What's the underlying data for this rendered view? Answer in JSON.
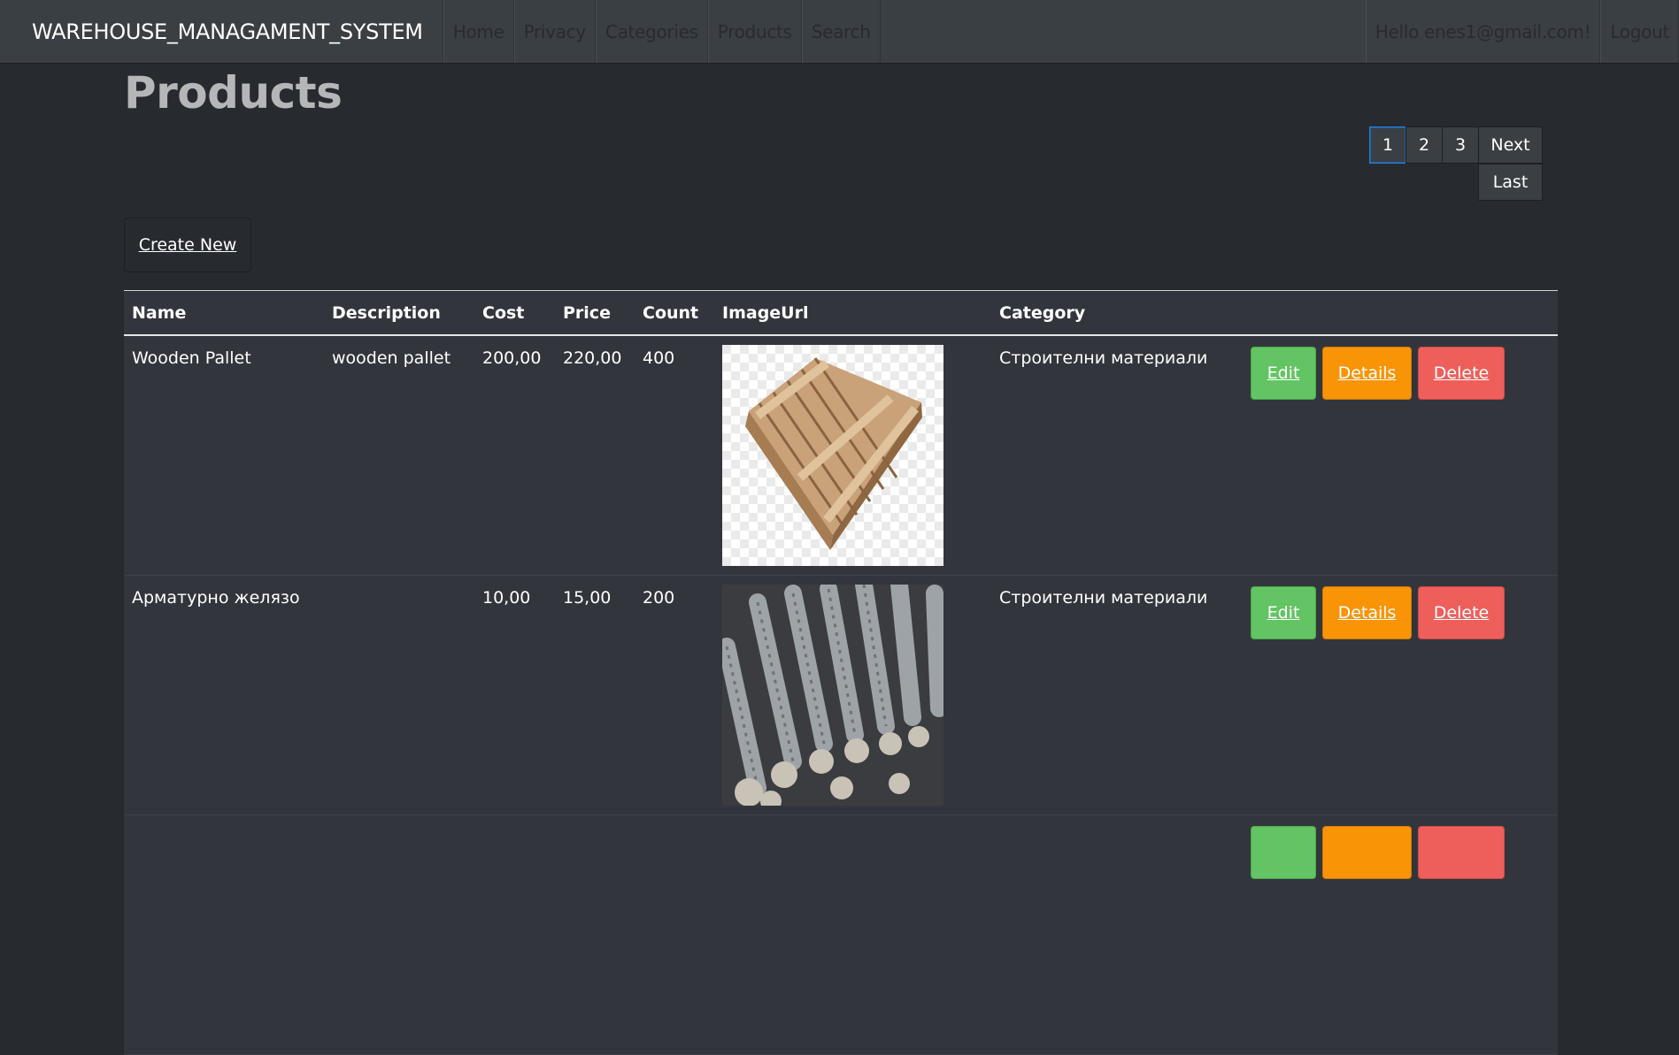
{
  "navbar": {
    "brand": "WAREHOUSE_MANAGAMENT_SYSTEM",
    "items": [
      "Home",
      "Privacy",
      "Categories",
      "Products",
      "Search"
    ],
    "greeting": "Hello enes1@gmail.com!",
    "logout": "Logout"
  },
  "page": {
    "title": "Products",
    "create_new": "Create New"
  },
  "pagination": {
    "pages": [
      "1",
      "2",
      "3"
    ],
    "active": "1",
    "next": "Next",
    "last": "Last"
  },
  "table": {
    "headers": [
      "Name",
      "Description",
      "Cost",
      "Price",
      "Count",
      "ImageUrl",
      "Category"
    ],
    "rows": [
      {
        "name": "Wooden Pallet",
        "description": "wooden pallet",
        "cost": "200,00",
        "price": "220,00",
        "count": "400",
        "image": "wooden-pallet-image",
        "category": "Строителни материали"
      },
      {
        "name": "Арматурно желязо",
        "description": "",
        "cost": "10,00",
        "price": "15,00",
        "count": "200",
        "image": "rebar-image",
        "category": "Строителни материали"
      }
    ],
    "actions": {
      "edit": "Edit",
      "details": "Details",
      "delete": "Delete"
    }
  },
  "colors": {
    "background": "#272b30",
    "navbar": "#3a3f44",
    "edit": "#62c462",
    "details": "#f89406",
    "delete": "#ee5f5b"
  }
}
